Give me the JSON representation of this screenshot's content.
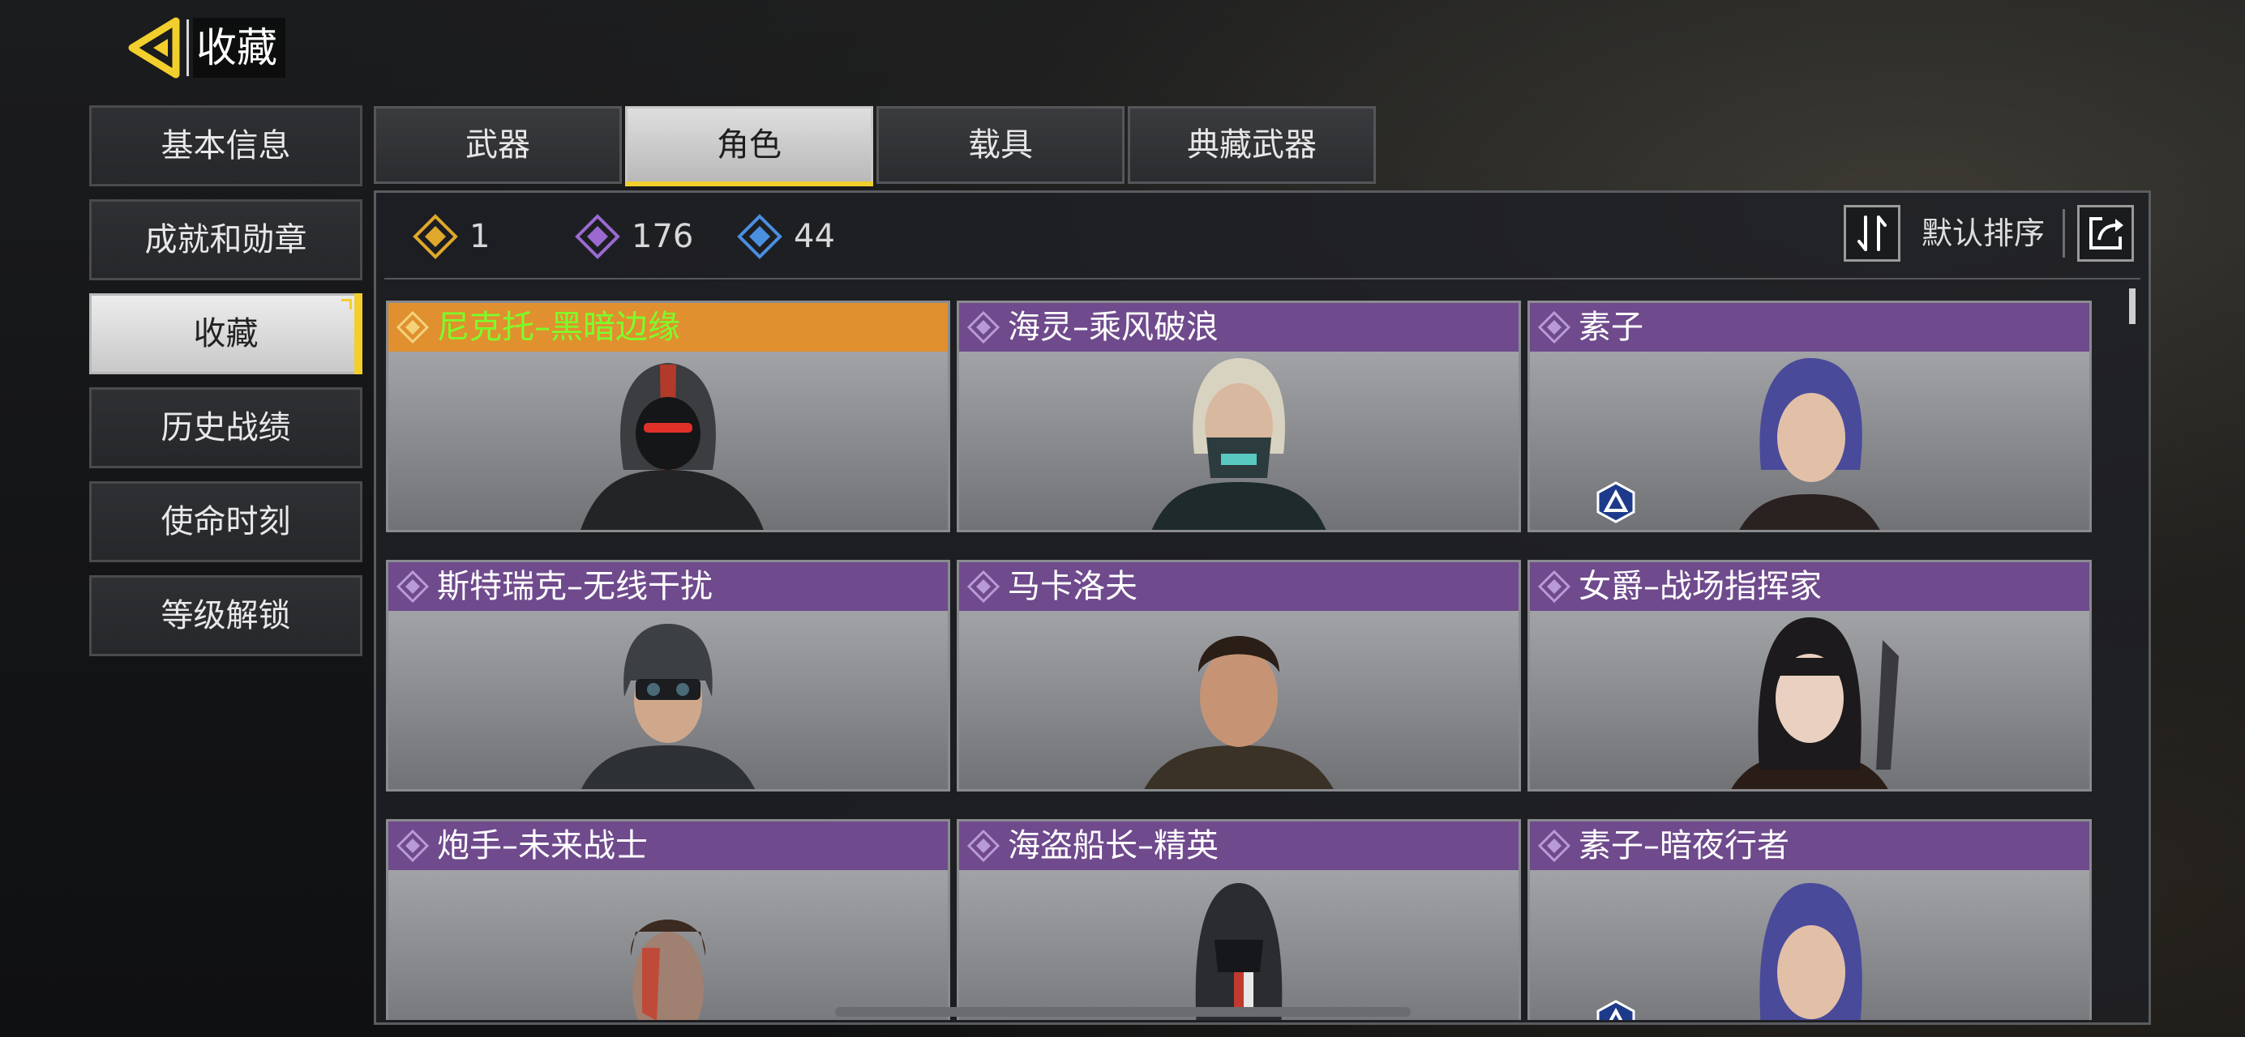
{
  "header": {
    "title": "收藏",
    "back_icon": "back-arrow-icon",
    "accent": "#f2cf2c"
  },
  "sidebar": {
    "items": [
      {
        "label": "基本信息",
        "active": false
      },
      {
        "label": "成就和勋章",
        "active": false
      },
      {
        "label": "收藏",
        "active": true
      },
      {
        "label": "历史战绩",
        "active": false
      },
      {
        "label": "使命时刻",
        "active": false
      },
      {
        "label": "等级解锁",
        "active": false
      }
    ]
  },
  "tabs": [
    {
      "label": "武器",
      "active": false
    },
    {
      "label": "角色",
      "active": true
    },
    {
      "label": "载具",
      "active": false
    },
    {
      "label": "典藏武器",
      "active": false
    }
  ],
  "stats": [
    {
      "icon": "gold-diamond-icon",
      "color": "#e0a82a",
      "count": "1"
    },
    {
      "icon": "purple-diamond-icon",
      "color": "#9a6ad0",
      "count": "176"
    },
    {
      "icon": "blue-diamond-icon",
      "color": "#4a8fe0",
      "count": "44"
    }
  ],
  "sort": {
    "label": "默认排序",
    "icon": "sort-arrows-icon"
  },
  "export_icon": "share-export-icon",
  "cards": [
    {
      "name": "尼克托–黑暗边缘",
      "rarity": "gold",
      "badge": false
    },
    {
      "name": "海灵–乘风破浪",
      "rarity": "purple",
      "badge": false
    },
    {
      "name": "素子",
      "rarity": "purple",
      "badge": true
    },
    {
      "name": "斯特瑞克–无线干扰",
      "rarity": "purple",
      "badge": false
    },
    {
      "name": "马卡洛夫",
      "rarity": "purple",
      "badge": false
    },
    {
      "name": "女爵–战场指挥家",
      "rarity": "purple",
      "badge": false
    },
    {
      "name": "炮手–未来战士",
      "rarity": "purple",
      "badge": false
    },
    {
      "name": "海盗船长–精英",
      "rarity": "purple",
      "badge": false
    },
    {
      "name": "素子–暗夜行者",
      "rarity": "purple",
      "badge": true
    }
  ]
}
